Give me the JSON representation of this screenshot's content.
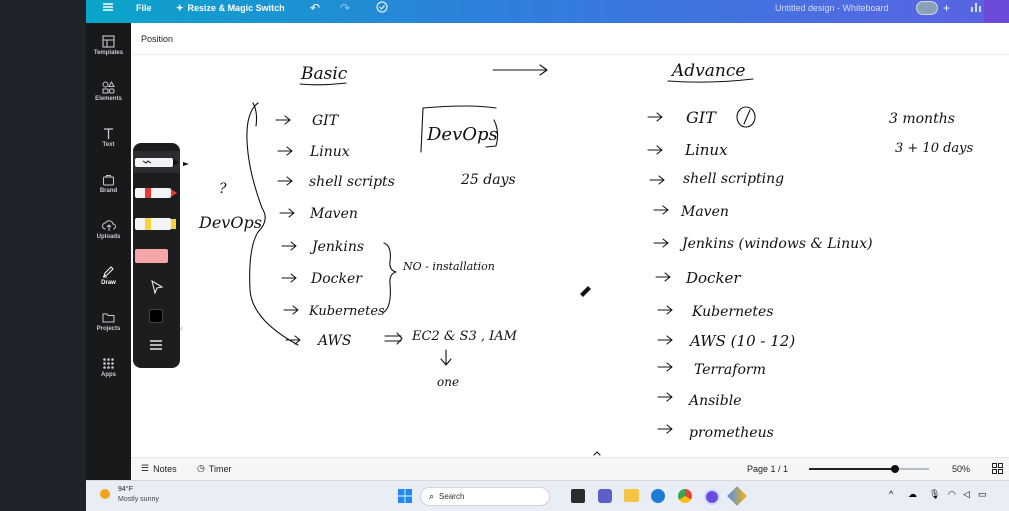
{
  "topbar": {
    "file": "File",
    "resize": "Resize & Magic Switch",
    "doc_title": "Untitled design - Whiteboard"
  },
  "sidebar": {
    "items": [
      {
        "label": "Templates",
        "icon": "templates-icon"
      },
      {
        "label": "Elements",
        "icon": "elements-icon"
      },
      {
        "label": "Text",
        "icon": "text-icon"
      },
      {
        "label": "Brand",
        "icon": "brand-icon"
      },
      {
        "label": "Uploads",
        "icon": "uploads-icon"
      },
      {
        "label": "Draw",
        "icon": "draw-icon"
      },
      {
        "label": "Projects",
        "icon": "projects-icon"
      },
      {
        "label": "Apps",
        "icon": "apps-icon"
      }
    ]
  },
  "subbar": {
    "position": "Position"
  },
  "whiteboard": {
    "basic_heading": "Basic",
    "advance_heading": "Advance",
    "devops_box": "DevOps",
    "devops_days": "25 days",
    "devops_side": "DevOps",
    "question_mark": "?",
    "basic_items": [
      "GIT",
      "Linux",
      "shell scripts",
      "Maven",
      "Jenkins",
      "Docker",
      "Kubernetes",
      "AWS"
    ],
    "no_install": "NO - installation",
    "aws_services": "EC2 & S3 , IAM",
    "one": "one",
    "advance_items": [
      "GIT",
      "Linux",
      "shell scripting",
      "Maven",
      "Jenkins (windows & Linux)",
      "Docker",
      "Kubernetes",
      "AWS (10 - 12)",
      "Terraform",
      "Ansible",
      "prometheus"
    ],
    "months": "3 months",
    "plus_days": "3 + 10 days"
  },
  "bottombar": {
    "notes": "Notes",
    "timer": "Timer",
    "page": "Page 1 / 1",
    "zoom_percent": "50%",
    "zoom_level": 0.72
  },
  "taskbar": {
    "temp": "94°F",
    "weather": "Mostly sunny",
    "search": "Search"
  },
  "colors": {
    "topbar_start": "#0aa5c9",
    "topbar_end": "#5b63e3",
    "sidebar": "#18191b",
    "pen_red": "#e53935",
    "pen_yellow": "#f6d43a",
    "pen_pink": "#f4a5a5"
  }
}
